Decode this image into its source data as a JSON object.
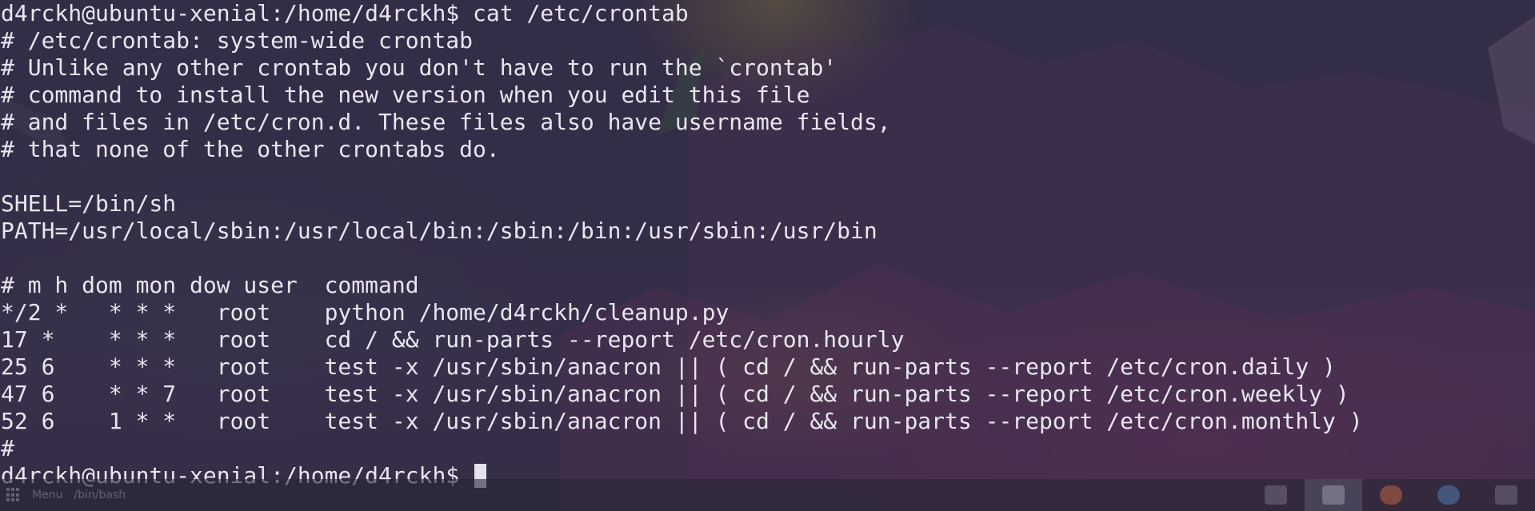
{
  "terminal": {
    "lines": [
      "d4rckh@ubuntu-xenial:/home/d4rckh$ cat /etc/crontab",
      "# /etc/crontab: system-wide crontab",
      "# Unlike any other crontab you don't have to run the `crontab'",
      "# command to install the new version when you edit this file",
      "# and files in /etc/cron.d. These files also have username fields,",
      "# that none of the other crontabs do.",
      "",
      "SHELL=/bin/sh",
      "PATH=/usr/local/sbin:/usr/local/bin:/sbin:/bin:/usr/sbin:/usr/bin",
      "",
      "# m h dom mon dow user  command",
      "*/2 *   * * *   root    python /home/d4rckh/cleanup.py",
      "17 *    * * *   root    cd / && run-parts --report /etc/cron.hourly",
      "25 6    * * *   root    test -x /usr/sbin/anacron || ( cd / && run-parts --report /etc/cron.daily )",
      "47 6    * * 7   root    test -x /usr/sbin/anacron || ( cd / && run-parts --report /etc/cron.weekly )",
      "52 6    1 * *   root    test -x /usr/sbin/anacron || ( cd / && run-parts --report /etc/cron.monthly )",
      "#"
    ],
    "prompt": "d4rckh@ubuntu-xenial:/home/d4rckh$ "
  },
  "taskbar": {
    "menu_label": "Menu",
    "task_label": "/bin/bash",
    "tray_icons": [
      "task-manager-icon",
      "terminal-icon",
      "firefox-icon",
      "chromium-icon",
      "files-icon"
    ]
  },
  "colors": {
    "text": "#e8e6ee",
    "terminal_background": "#3a3050"
  }
}
